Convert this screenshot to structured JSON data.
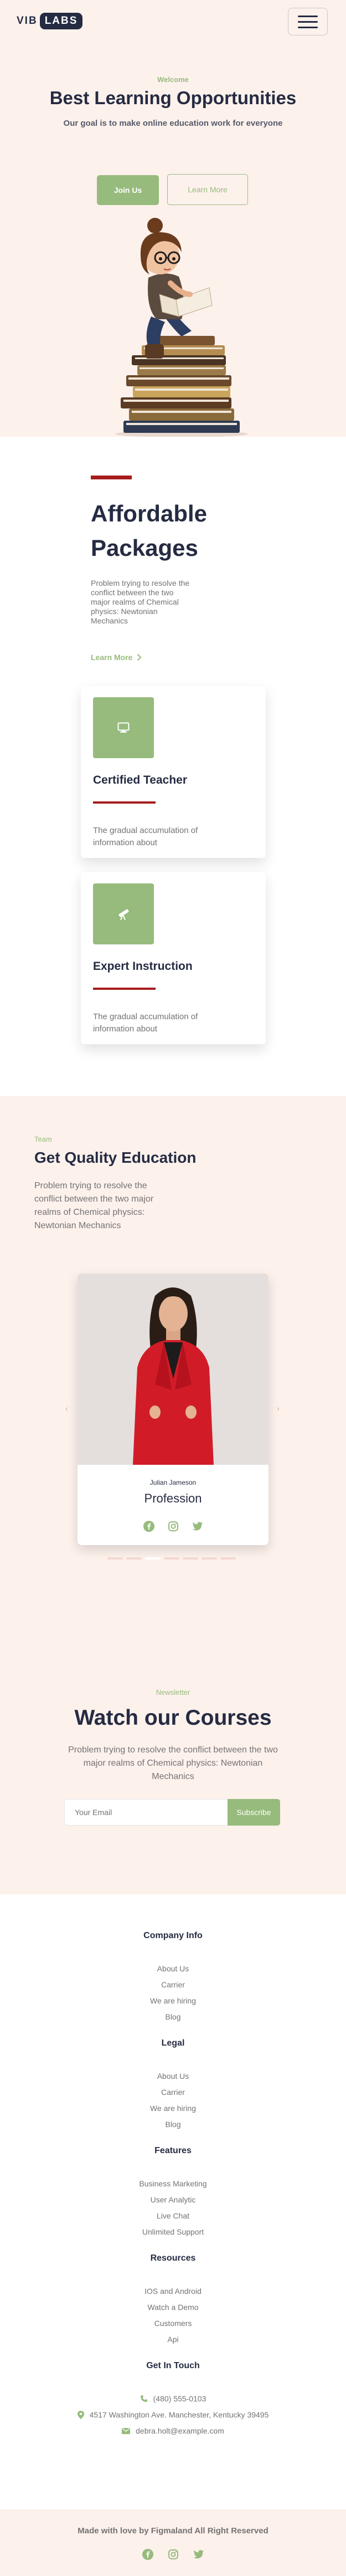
{
  "header": {
    "logo_text": "VIB",
    "logo_badge": "LABS",
    "menu_icon": "hamburger-icon"
  },
  "hero": {
    "eyebrow": "Welcome",
    "title": "Best Learning Opportunities",
    "subtitle": "Our goal is to make online education work for everyone",
    "join_label": "Join Us",
    "learn_label": "Learn More",
    "illustration": "girl-reading-on-books-illustration"
  },
  "packages": {
    "title_line1": "Affordable",
    "title_line2": "Packages",
    "description": "Problem trying to resolve the conflict between the two major realms of Chemical physics: Newtonian Mechanics",
    "link_label": "Learn More",
    "cards": [
      {
        "icon": "monitor-icon",
        "title": "Certified Teacher",
        "text": "The gradual accumulation of information about"
      },
      {
        "icon": "telescope-icon",
        "title": "Expert Instruction",
        "text": "The gradual accumulation of information about"
      }
    ]
  },
  "team": {
    "eyebrow": "Team",
    "title": "Get Quality Education",
    "description": "Problem trying to resolve the conflict between the two major realms of Chemical physics: Newtonian Mechanics",
    "member": {
      "name": "Julian Jameson",
      "role": "Profession",
      "social": [
        "facebook-icon",
        "instagram-icon",
        "twitter-icon"
      ]
    }
  },
  "newsletter": {
    "eyebrow": "Newsletter",
    "title": "Watch our Courses",
    "description": "Problem trying to resolve the conflict between the two major realms of Chemical physics: Newtonian Mechanics",
    "input_placeholder": "Your Email",
    "button_label": "Subscribe"
  },
  "footer": {
    "sections": [
      {
        "heading": "Company Info",
        "links": [
          "About Us",
          "Carrier",
          "We are hiring",
          "Blog"
        ]
      },
      {
        "heading": "Legal",
        "links": [
          "About Us",
          "Carrier",
          "We are hiring",
          "Blog"
        ]
      },
      {
        "heading": "Features",
        "links": [
          "Business Marketing",
          "User Analytic",
          "Live Chat",
          "Unlimited Support"
        ]
      },
      {
        "heading": "Resources",
        "links": [
          "IOS and Android",
          "Watch a Demo",
          "Customers",
          "Api"
        ]
      }
    ],
    "contact": {
      "heading": "Get In Touch",
      "phone": "(480) 555-0103",
      "address": "4517 Washington Ave. Manchester, Kentucky 39495",
      "email": "debra.holt@example.com"
    },
    "bottom_text": "Made with love by Figmaland All Right Reserved"
  },
  "colors": {
    "accent": "#96bb7c",
    "dark": "#252b42",
    "red": "#a71c1c",
    "blush": "#fdf1ec",
    "muted": "#737373"
  }
}
